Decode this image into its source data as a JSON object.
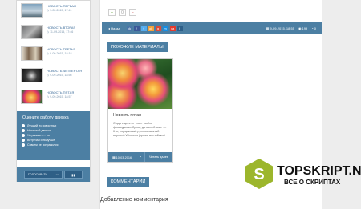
{
  "sidebar": {
    "news": [
      {
        "title": "НОВОСТЬ ПЕРВАЯ",
        "date": "9-02-2015, 17:41"
      },
      {
        "title": "НОВОСТЬ ВТОРАЯ",
        "date": "11-09-2015, 17:46"
      },
      {
        "title": "НОВОСТЬ ТРЕТЬЯ",
        "date": "9-09-2015, 18:18"
      },
      {
        "title": "НОВОСТЬ ЧЕТВЁРТАЯ",
        "date": "9-09-2015, 18:56"
      },
      {
        "title": "НОВОСТЬ ПЯТАЯ",
        "date": "9-09-2015, 18:57"
      }
    ],
    "poll": {
      "title": "Оцените работу движка",
      "options": [
        "Лучший из новостных",
        "Неплохой движок",
        "Устраивает ... но",
        "Встречал и получше",
        "Совсем не понравился"
      ],
      "vote_label": "ГОЛОСОВАТЬ"
    }
  },
  "main": {
    "rating": {
      "plus": "+",
      "neutral": "0",
      "minus": "−"
    },
    "postbar": {
      "back_label": "Назад",
      "socials": [
        "vk",
        "f",
        "t",
        "ok",
        "g",
        "m",
        "ya",
        "lj"
      ],
      "date": "9-09-2015, 18:55",
      "views": "199",
      "comments": "0"
    },
    "related_title": "ПОХОЖИЕ МАТЕРИАЛЫ",
    "card": {
      "title": "Новость пятая",
      "text": "Сюда еще этот текст рыбно французских булок, да выпей чаю. — Кто, порядковый русскоязычный версией Windows (кроме английской",
      "date": "10-03-2016",
      "more": "Читать далее"
    },
    "comments_title": "КОММЕНТАРИИ",
    "add_comment": "Добавление комментария"
  },
  "watermark": {
    "letter": "S",
    "title": "TOPSKRIPT.NET",
    "subtitle": "ВСЕ О СКРИПТАХ"
  },
  "colors": {
    "accent": "#4c7fa3",
    "dark_accent": "#2e5f86",
    "link": "#3b6b99",
    "logo": "#9cb62c"
  }
}
